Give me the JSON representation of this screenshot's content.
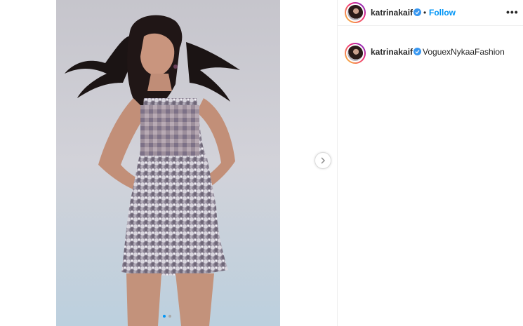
{
  "post": {
    "header": {
      "username": "katrinakaif",
      "separator": "•",
      "follow_label": "Follow",
      "more_icon": "more-options-icon",
      "more_label": "•••"
    },
    "caption": {
      "username": "katrinakaif",
      "text": "VoguexNykaaFashion"
    },
    "media": {
      "carousel_count": 2,
      "current_index": 1,
      "next_icon": "chevron-right-icon"
    }
  },
  "colors": {
    "link_blue": "#0095f6",
    "verified_blue": "#3897f0",
    "text": "#262626",
    "divider": "#efefef"
  }
}
